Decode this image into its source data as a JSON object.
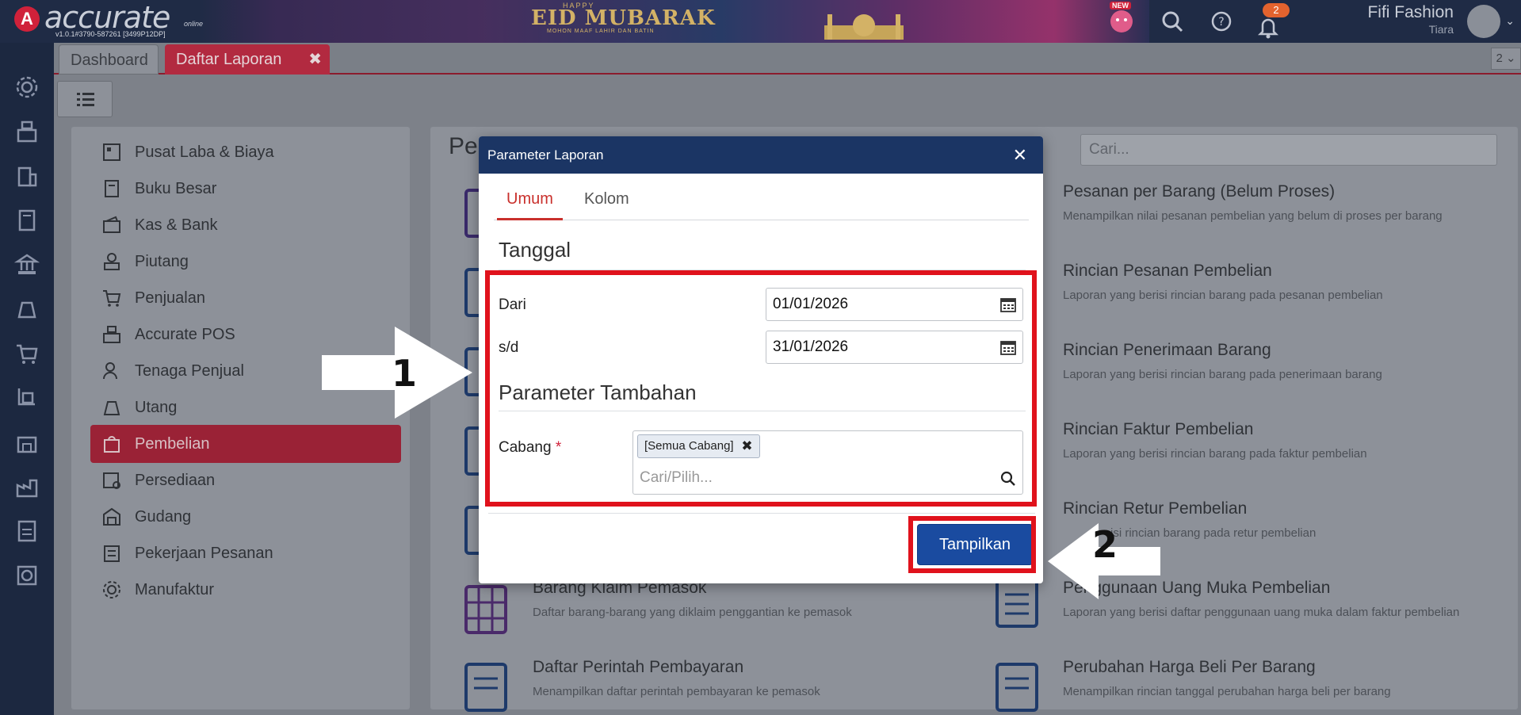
{
  "app": {
    "logo_letter": "A",
    "logo_text": "accurate",
    "logo_online": "online",
    "version": "v1.0.1#3790-587261 [3499P12DP]",
    "banner_top": "HAPPY",
    "banner_main": "EID MUBARAK",
    "banner_sub": "MOHON MAAF LAHIR DAN BATIN",
    "new_label": "NEW",
    "notification_count": "2",
    "company": "Fifi Fashion",
    "user": "Tiara"
  },
  "tabs": {
    "dashboard": "Dashboard",
    "active": "Daftar Laporan",
    "close": "✖",
    "count": "2 ⌄"
  },
  "sidebar": {
    "items": [
      {
        "label": "Pusat Laba & Biaya"
      },
      {
        "label": "Buku Besar"
      },
      {
        "label": "Kas & Bank"
      },
      {
        "label": "Piutang"
      },
      {
        "label": "Penjualan"
      },
      {
        "label": "Accurate POS"
      },
      {
        "label": "Tenaga Penjual"
      },
      {
        "label": "Utang"
      },
      {
        "label": "Pembelian"
      },
      {
        "label": "Persediaan"
      },
      {
        "label": "Gudang"
      },
      {
        "label": "Pekerjaan Pesanan"
      },
      {
        "label": "Manufaktur"
      }
    ]
  },
  "main": {
    "title": "Pe",
    "search_placeholder": "Cari...",
    "reports_right": [
      {
        "title": "Pesanan per Barang (Belum Proses)",
        "desc": "Menampilkan nilai pesanan pembelian yang belum di proses per barang"
      },
      {
        "title": "Rincian Pesanan Pembelian",
        "desc": "Laporan yang berisi rincian barang pada pesanan pembelian"
      },
      {
        "title": "Rincian Penerimaan Barang",
        "desc": "Laporan yang berisi rincian barang pada penerimaan barang"
      },
      {
        "title": "Rincian Faktur Pembelian",
        "desc": "Laporan yang berisi rincian barang pada faktur pembelian"
      },
      {
        "title": "Rincian Retur Pembelian",
        "desc": "isi rincian barang pada retur pembelian"
      },
      {
        "title": "Penggunaan Uang Muka Pembelian",
        "desc": "Laporan yang berisi daftar penggunaan uang muka dalam faktur pembelian"
      },
      {
        "title": "Perubahan Harga Beli Per Barang",
        "desc": "Menampilkan rincian tanggal perubahan harga beli per barang"
      }
    ],
    "reports_left": [
      {
        "title": "Barang Klaim Pemasok",
        "desc": "Daftar barang-barang yang diklaim penggantian ke pemasok"
      },
      {
        "title": "Daftar Perintah Pembayaran",
        "desc": "Menampilkan daftar perintah pembayaran ke pemasok"
      }
    ]
  },
  "modal": {
    "title": "Parameter Laporan",
    "close": "✕",
    "tab_umum": "Umum",
    "tab_kolom": "Kolom",
    "section_tanggal": "Tanggal",
    "label_dari": "Dari",
    "value_dari": "01/01/2026",
    "label_sd": "s/d",
    "value_sd": "31/01/2026",
    "section_tambahan": "Parameter Tambahan",
    "label_cabang": "Cabang",
    "required_mark": "*",
    "chip_cabang": "[Semua Cabang]",
    "chip_remove": "✖",
    "placeholder_cabang": "Cari/Pilih...",
    "button_tampilkan": "Tampilkan"
  },
  "annotations": {
    "step1": "1",
    "step2": "2"
  },
  "colors": {
    "accent_red": "#c9302c",
    "modal_header": "#1b3564",
    "primary_button": "#1a4ba0",
    "annotation_red": "#e0121c"
  }
}
